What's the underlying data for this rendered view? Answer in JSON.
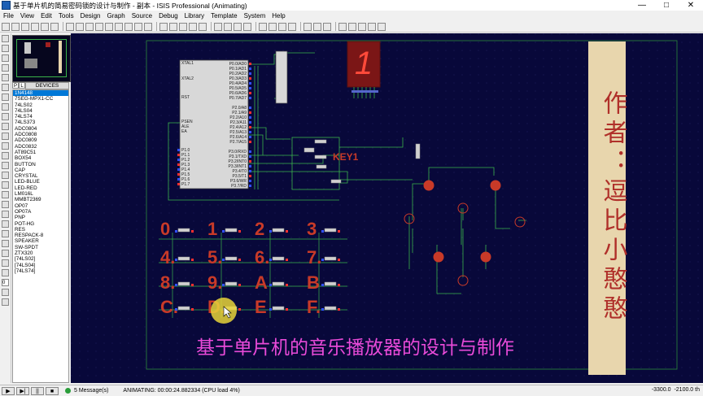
{
  "window": {
    "title": "基于单片机的简易密码锁的设计与制作 - 副本 - ISIS Professional (Animating)",
    "min": "—",
    "max": "□",
    "close": "✕"
  },
  "menu": [
    "File",
    "View",
    "Edit",
    "Tools",
    "Design",
    "Graph",
    "Source",
    "Debug",
    "Library",
    "Template",
    "System",
    "Help"
  ],
  "devices": {
    "p_label": "P",
    "l_label": "L",
    "header": "DEVICES",
    "items": [
      "1N4148",
      "7SEG-MPX1-CC",
      "74LS02",
      "74LS04",
      "74LS74",
      "74LS373",
      "ADC0804",
      "ADC0808",
      "ADC0809",
      "ADC0832",
      "AT89C51",
      "BOX54",
      "BUTTON",
      "CAP",
      "CRYSTAL",
      "LED-BLUE",
      "LED-RED",
      "LM016L",
      "MMBT2369",
      "OP07",
      "OP07A",
      "PNP",
      "POT-HG",
      "RES",
      "RESPACK-8",
      "SPEAKER",
      "SW-SPDT",
      "ZTX320",
      "[74LS02]",
      "[74LS04]",
      "[74LS74]"
    ]
  },
  "schematic": {
    "mcu_left_pins": [
      "XTAL1",
      "XTAL2",
      "RST",
      "PSEN",
      "ALE",
      "EA",
      "P1.0",
      "P1.1",
      "P1.2",
      "P1.3",
      "P1.4",
      "P1.5",
      "P1.6",
      "P1.7"
    ],
    "mcu_right_pins": [
      "P0.0/AD0",
      "P0.1/AD1",
      "P0.2/AD2",
      "P0.3/AD3",
      "P0.4/AD4",
      "P0.5/AD5",
      "P0.6/AD6",
      "P0.7/AD7",
      "P2.0/A8",
      "P2.1/A9",
      "P2.2/A10",
      "P2.3/A11",
      "P2.4/A12",
      "P2.5/A13",
      "P2.6/A14",
      "P2.7/A15",
      "P3.0/RXD",
      "P3.1/TXD",
      "P3.2/INT0",
      "P3.3/INT1",
      "P3.4/T0",
      "P3.5/T1",
      "P3.6/WR",
      "P3.7/RD"
    ],
    "seg_digit": "1",
    "key1_label": "KEY1",
    "keys": [
      "0",
      "1",
      "2",
      "3",
      "4.",
      "5.",
      "6.",
      "7.",
      "8.",
      "9.",
      "A",
      "B",
      "C.",
      "D.",
      "E",
      "F."
    ],
    "author": "作者：逗比小憨憨",
    "caption": "基于单片机的音乐播放器的设计与制作"
  },
  "status": {
    "messages": "5 Message(s)",
    "animating": "ANIMATING: 00:00:24.882334 (CPU load 4%)",
    "x": "-3300.0",
    "y": "-2100.0",
    "unit": "th",
    "zoom": "0"
  },
  "colors": {
    "canvas_bg": "#08083a",
    "wire": "#3ab34a",
    "component": "#c83a28",
    "label_magenta": "#e84ad8",
    "author_panel": "#e8d6ad"
  }
}
